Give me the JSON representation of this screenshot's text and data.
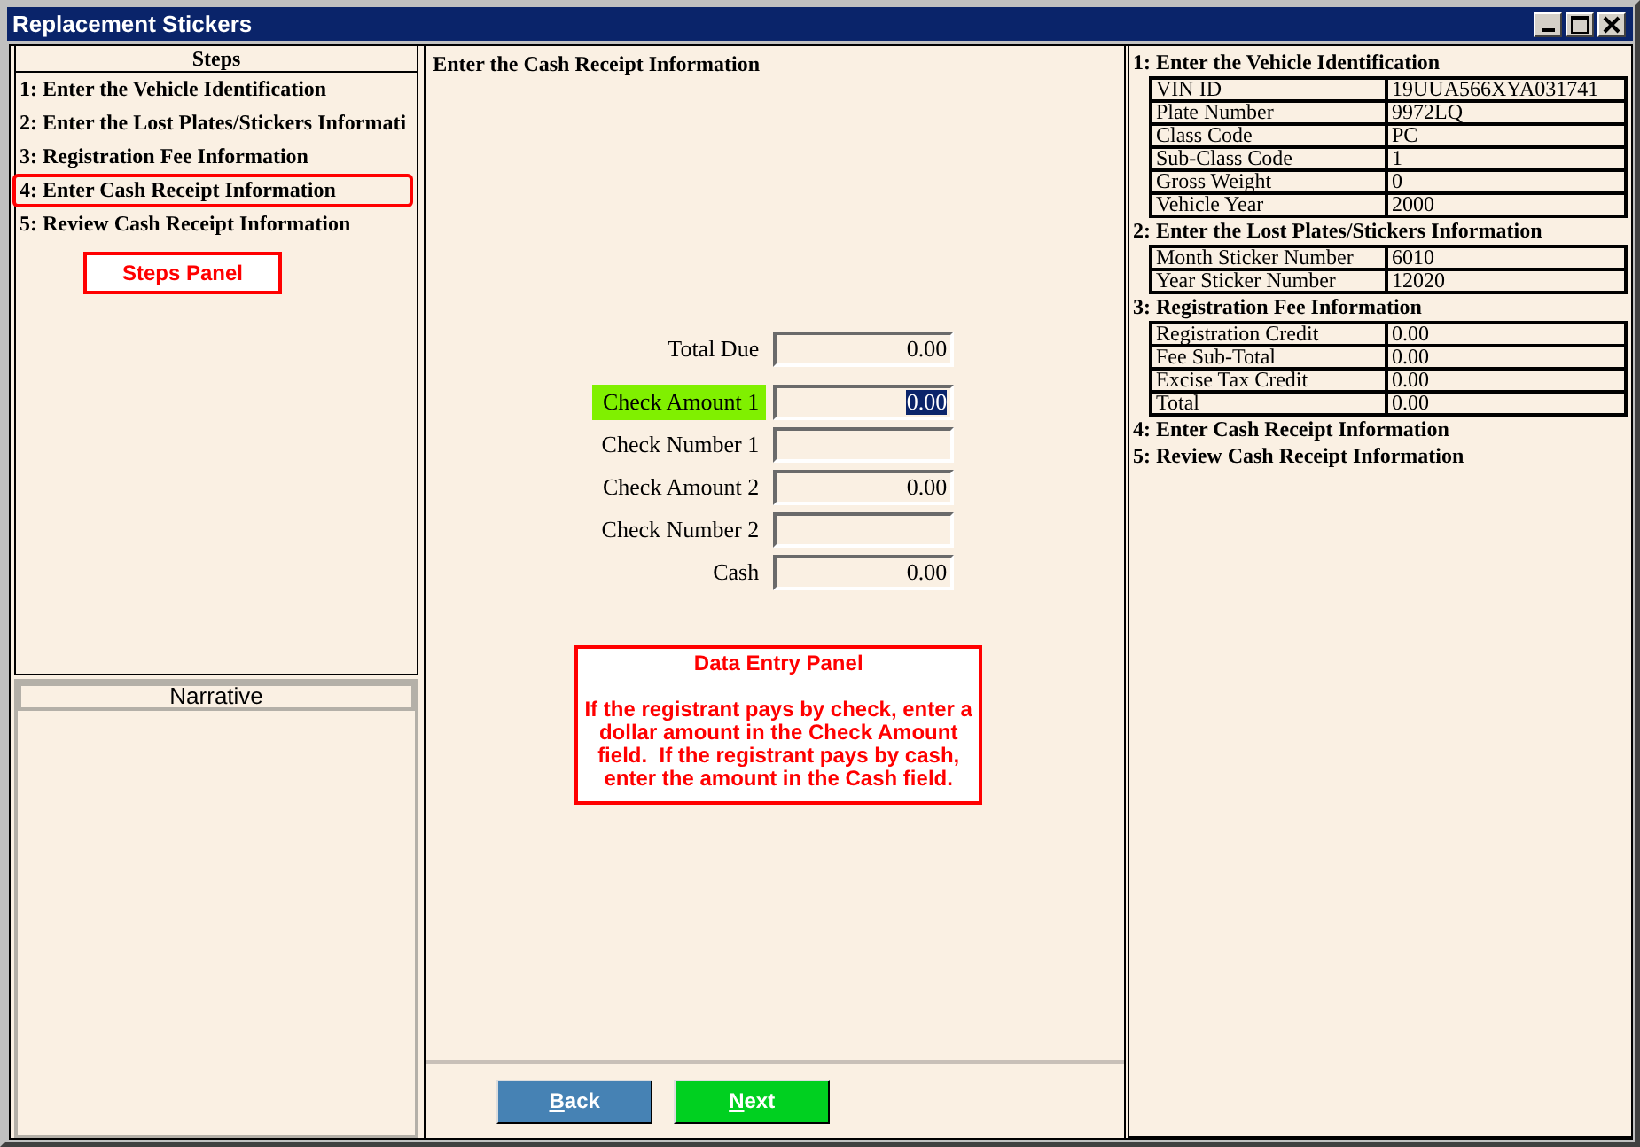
{
  "window": {
    "title": "Replacement Stickers"
  },
  "steps": {
    "title": "Steps",
    "items": [
      {
        "label": "1: Enter the Vehicle Identification",
        "selected": false
      },
      {
        "label": "2: Enter the Lost Plates/Stickers Informati",
        "selected": false
      },
      {
        "label": "3: Registration Fee Information",
        "selected": false
      },
      {
        "label": "4: Enter Cash Receipt Information",
        "selected": true
      },
      {
        "label": "5: Review Cash Receipt Information",
        "selected": false
      }
    ],
    "callout": "Steps Panel"
  },
  "narrative": {
    "title": "Narrative"
  },
  "entry": {
    "title": "Enter the Cash Receipt Information",
    "fields": [
      {
        "label": "Total Due",
        "value": "0.00",
        "focused": false
      },
      {
        "label": "Check Amount 1",
        "value": "0.00",
        "focused": true
      },
      {
        "label": "Check Number 1",
        "focused": false
      },
      {
        "label": "Check Amount 2",
        "value": "0.00",
        "focused": false
      },
      {
        "label": "Check Number 2",
        "focused": false
      },
      {
        "label": "Cash",
        "value": "0.00",
        "focused": false
      }
    ],
    "callout": {
      "title": "Data Entry Panel",
      "text": "If the registrant pays by check, enter a dollar amount in the Check Amount field.  If the registrant pays by cash, enter the amount in the Cash field."
    }
  },
  "buttons": [
    {
      "label": "Back",
      "kind": "back"
    },
    {
      "label": "Next",
      "kind": "next"
    }
  ],
  "summary": [
    {
      "heading": "1: Enter the Vehicle Identification",
      "rows": [
        [
          "VIN ID",
          "19UUA566XYA031741"
        ],
        [
          "Plate Number",
          "9972LQ"
        ],
        [
          "Class Code",
          "PC"
        ],
        [
          "Sub-Class Code",
          "1"
        ],
        [
          "Gross Weight",
          "0"
        ],
        [
          "Vehicle Year",
          "2000"
        ]
      ]
    },
    {
      "heading": "2: Enter the Lost Plates/Stickers Information",
      "rows": [
        [
          "Month Sticker Number",
          "6010"
        ],
        [
          "Year Sticker Number",
          "12020"
        ]
      ]
    },
    {
      "heading": "3: Registration Fee Information",
      "rows": [
        [
          "Registration Credit",
          "0.00"
        ],
        [
          "Fee Sub-Total",
          "0.00"
        ],
        [
          "Excise Tax Credit",
          "0.00"
        ],
        [
          "Total",
          "0.00"
        ]
      ]
    },
    {
      "heading": "4: Enter Cash Receipt Information"
    },
    {
      "heading": "5: Review Cash Receipt Information"
    }
  ]
}
